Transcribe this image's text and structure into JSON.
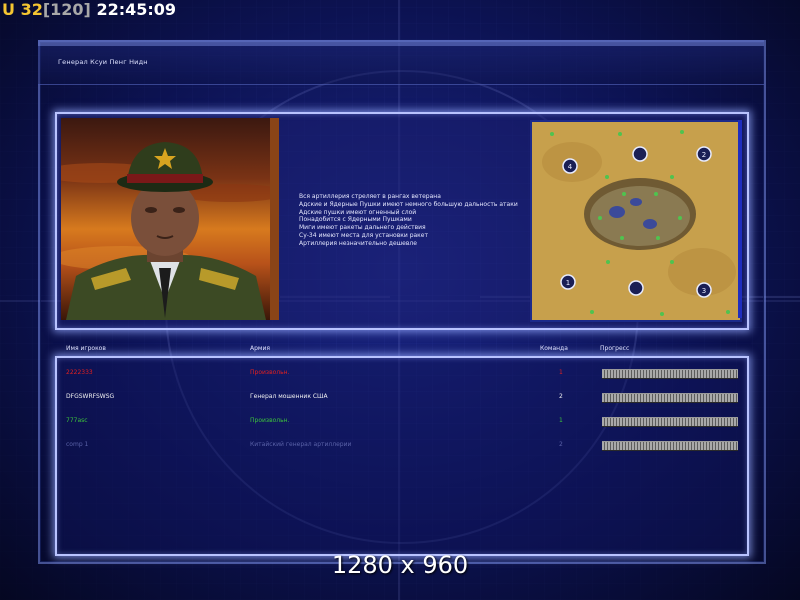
{
  "hud": {
    "prefix": "U",
    "level": "32",
    "max": "[120]",
    "time": "22:45:09"
  },
  "general": {
    "name": "Генерал Ксуи Пенг Нидн"
  },
  "description": [
    "Вся артиллерия стреляет в рангах ветерана",
    "Адские и Ядерные Пушки имеют немного большую дальность атаки",
    "Адские пушки имеют огненный слой",
    "Понадобится с Ядерными Пушками",
    "Миги имеют ракеты дальнего действия",
    "Су-34 имеют места для установки ракет",
    "Артиллерия незначительно дешевле"
  ],
  "table": {
    "headers": {
      "name": "Имя игроков",
      "army": "Армия",
      "team": "Команда",
      "progress": "Прогресс"
    },
    "rows": [
      {
        "name": "2222333",
        "army": "Произвольн.",
        "team": "1",
        "color": "#e02020",
        "progress": 1.0
      },
      {
        "name": "DFGSWRFSWSG",
        "army": "Генерал мошенник США",
        "team": "2",
        "color": "#f2f2f2",
        "progress": 1.0
      },
      {
        "name": "777asc",
        "army": "Произвольн.",
        "team": "1",
        "color": "#3cc33c",
        "progress": 1.0
      },
      {
        "name": "comp 1",
        "army": "Китайский генерал артиллерии",
        "team": "2",
        "color": "#5a62a8",
        "progress": 1.0
      }
    ]
  },
  "resolution_label": "1280 x 960",
  "colors": {
    "hud_accent": "#f4c531",
    "panel_border": "#b9c3ff",
    "background": "#0d145a"
  }
}
